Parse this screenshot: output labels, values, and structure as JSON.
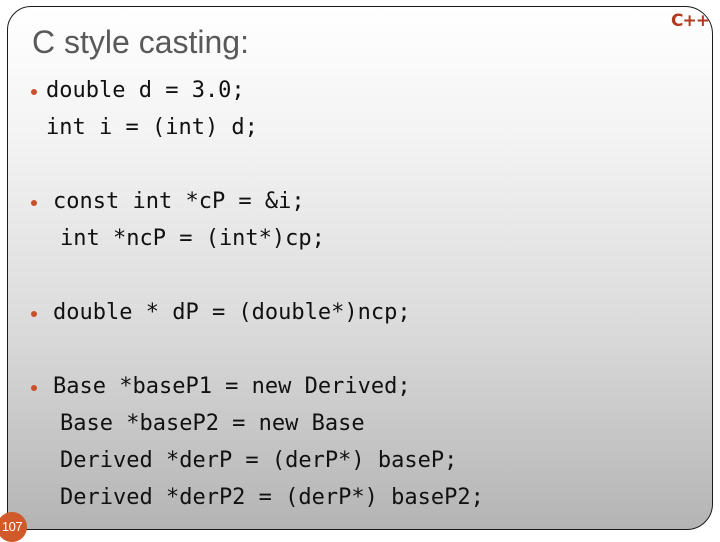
{
  "slide": {
    "title": "C style casting:",
    "logo": "C++",
    "page_number": "107",
    "bullets": [
      {
        "lines": [
          "double d = 3.0;",
          "int i = (int) d;"
        ]
      },
      {
        "lines": [
          "const int *cP = &i;",
          "int *ncP = (int*)cp;"
        ]
      },
      {
        "lines": [
          "double * dP = (double*)ncp;"
        ]
      },
      {
        "lines": [
          "Base *baseP1 = new Derived;",
          "Base *baseP2 = new Base",
          "Derived *derP = (derP*) baseP;",
          "Derived *derP2 = (derP*) baseP2;"
        ]
      }
    ],
    "colors": {
      "accent": "#c9502c",
      "title": "#595959",
      "logo": "#b03a1e"
    }
  }
}
